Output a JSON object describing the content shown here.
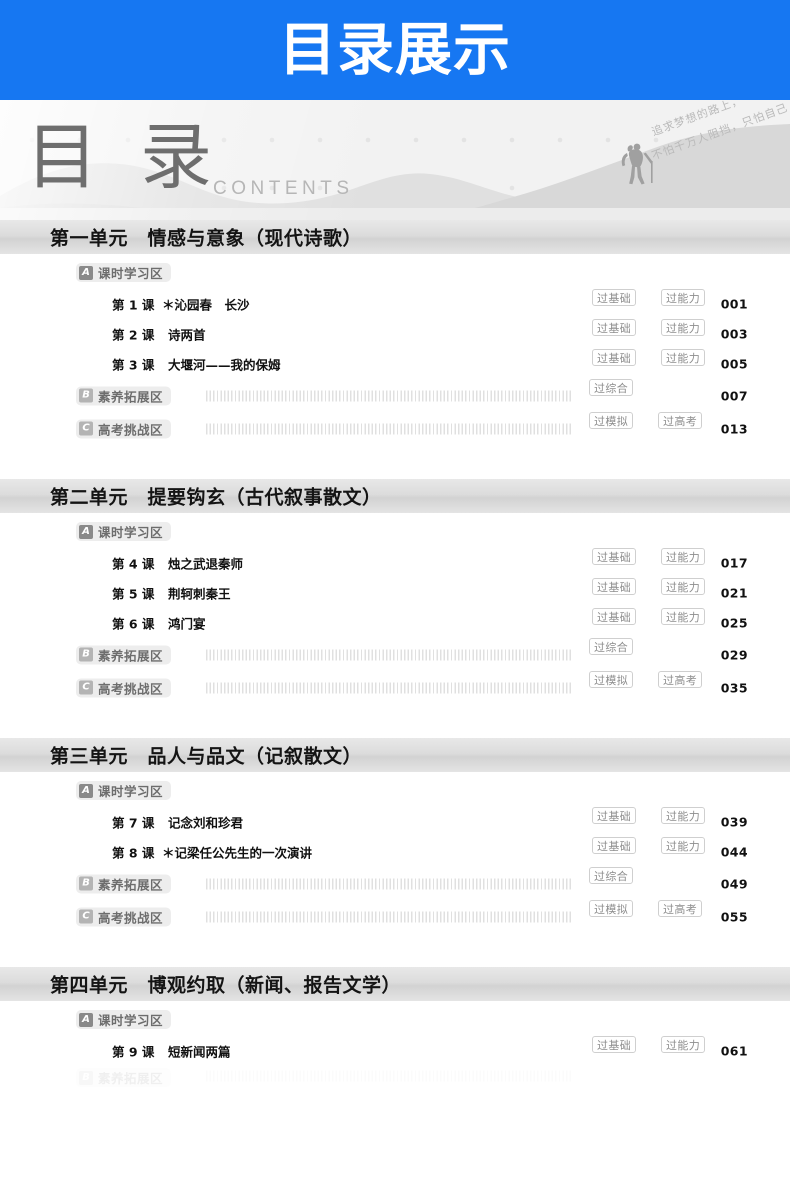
{
  "banner": {
    "title": "目录展示",
    "color": "#1677f2"
  },
  "hero": {
    "title": "目 录",
    "subtitle": "CONTENTS",
    "quote_line1": "追求梦想的路上，",
    "quote_line2": "不怕千万人阻挡，只怕自己",
    "icons": {
      "hiker": "hiker-icon",
      "hills": "mountain-hills-icon"
    }
  },
  "tag_labels": {
    "basics": "过基础",
    "ability": "过能力",
    "comprehensive": "过综合",
    "mock": "过模拟",
    "gaokao": "过高考"
  },
  "zone_labels": {
    "a": "课时学习区",
    "b": "素养拓展区",
    "c": "高考挑战区"
  },
  "zone_letters": {
    "a": "A",
    "b": "B",
    "c": "C"
  },
  "units": [
    {
      "title": "第一单元　情感与意象（现代诗歌）",
      "lessons": [
        {
          "no": "第 1 课",
          "title": "＊沁园春　长沙",
          "star": true,
          "tags": [
            "过基础",
            "过能力"
          ],
          "page": "001"
        },
        {
          "no": "第 2 课",
          "title": "诗两首",
          "star": false,
          "tags": [
            "过基础",
            "过能力"
          ],
          "page": "003"
        },
        {
          "no": "第 3 课",
          "title": "大堰河——我的保姆",
          "star": false,
          "tags": [
            "过基础",
            "过能力"
          ],
          "page": "005"
        }
      ],
      "zones": [
        {
          "letter": "B",
          "label": "素养拓展区",
          "tags": [
            "过综合"
          ],
          "page": "007"
        },
        {
          "letter": "C",
          "label": "高考挑战区",
          "tags": [
            "过模拟",
            "过高考"
          ],
          "page": "013"
        }
      ]
    },
    {
      "title": "第二单元　提要钩玄（古代叙事散文）",
      "lessons": [
        {
          "no": "第 4 课",
          "title": "烛之武退秦师",
          "star": false,
          "tags": [
            "过基础",
            "过能力"
          ],
          "page": "017"
        },
        {
          "no": "第 5 课",
          "title": "荆轲刺秦王",
          "star": false,
          "tags": [
            "过基础",
            "过能力"
          ],
          "page": "021"
        },
        {
          "no": "第 6 课",
          "title": "鸿门宴",
          "star": false,
          "tags": [
            "过基础",
            "过能力"
          ],
          "page": "025"
        }
      ],
      "zones": [
        {
          "letter": "B",
          "label": "素养拓展区",
          "tags": [
            "过综合"
          ],
          "page": "029"
        },
        {
          "letter": "C",
          "label": "高考挑战区",
          "tags": [
            "过模拟",
            "过高考"
          ],
          "page": "035"
        }
      ]
    },
    {
      "title": "第三单元　品人与品文（记叙散文）",
      "lessons": [
        {
          "no": "第 7 课",
          "title": "记念刘和珍君",
          "star": false,
          "tags": [
            "过基础",
            "过能力"
          ],
          "page": "039"
        },
        {
          "no": "第 8 课",
          "title": "＊记梁任公先生的一次演讲",
          "star": true,
          "tags": [
            "过基础",
            "过能力"
          ],
          "page": "044"
        }
      ],
      "zones": [
        {
          "letter": "B",
          "label": "素养拓展区",
          "tags": [
            "过综合"
          ],
          "page": "049"
        },
        {
          "letter": "C",
          "label": "高考挑战区",
          "tags": [
            "过模拟",
            "过高考"
          ],
          "page": "055"
        }
      ]
    },
    {
      "title": "第四单元　博观约取（新闻、报告文学）",
      "lessons": [
        {
          "no": "第 9 课",
          "title": "短新闻两篇",
          "star": false,
          "tags": [
            "过基础",
            "过能力"
          ],
          "page": "061"
        }
      ],
      "zones": []
    }
  ]
}
